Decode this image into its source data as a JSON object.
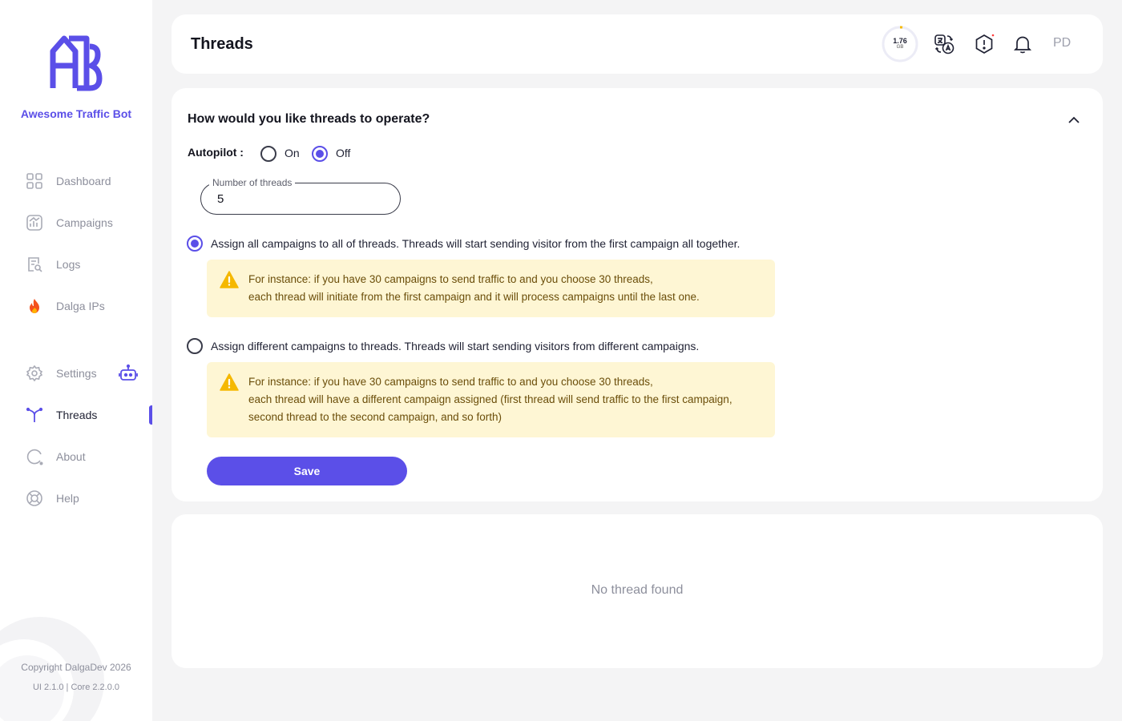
{
  "app": {
    "name": "Awesome Traffic Bot",
    "logo_text": "ATB"
  },
  "sidebar": {
    "items": [
      {
        "label": "Dashboard",
        "icon": "dashboard-icon"
      },
      {
        "label": "Campaigns",
        "icon": "campaigns-icon"
      },
      {
        "label": "Logs",
        "icon": "logs-icon"
      },
      {
        "label": "Dalga IPs",
        "icon": "fire-icon"
      },
      {
        "label": "Settings",
        "icon": "gear-icon"
      },
      {
        "label": "Threads",
        "icon": "threads-icon",
        "active": true
      },
      {
        "label": "About",
        "icon": "about-icon"
      },
      {
        "label": "Help",
        "icon": "lifebuoy-icon"
      }
    ],
    "copyright": "Copyright DalgaDev 2026",
    "version": "UI 2.1.0 | Core 2.2.0.0"
  },
  "header": {
    "title": "Threads",
    "usage_value": "1.76",
    "usage_unit": "GB",
    "avatar": "PD",
    "icons": [
      "translate-icon",
      "alert-icon",
      "bell-icon"
    ]
  },
  "threads_form": {
    "question": "How would you like threads to operate?",
    "autopilot_label": "Autopilot :",
    "autopilot_on": "On",
    "autopilot_off": "Off",
    "autopilot_selected": "Off",
    "threads_field_label": "Number of threads",
    "threads_field_value": "5",
    "options": [
      {
        "label": "Assign all campaigns to all of threads. Threads will start sending visitor from the first campaign all together.",
        "selected": true,
        "note_lines": [
          "For instance: if you have 30 campaigns to send traffic to and you choose 30 threads,",
          "each thread will initiate from the first campaign and it will process campaigns until the last one."
        ]
      },
      {
        "label": "Assign different campaigns to threads. Threads will start sending visitors from different campaigns.",
        "selected": false,
        "note_lines": [
          "For instance: if you have 30 campaigns to send traffic to and you choose 30 threads,",
          "each thread will have a different campaign assigned (first thread will send traffic to the first campaign,",
          "second thread to the second campaign, and so forth)"
        ]
      }
    ],
    "save_label": "Save"
  },
  "threads_list": {
    "empty_text": "No thread found"
  },
  "colors": {
    "accent": "#5b4fe8",
    "note_bg": "#fef6d4",
    "warning": "#f5b800"
  }
}
